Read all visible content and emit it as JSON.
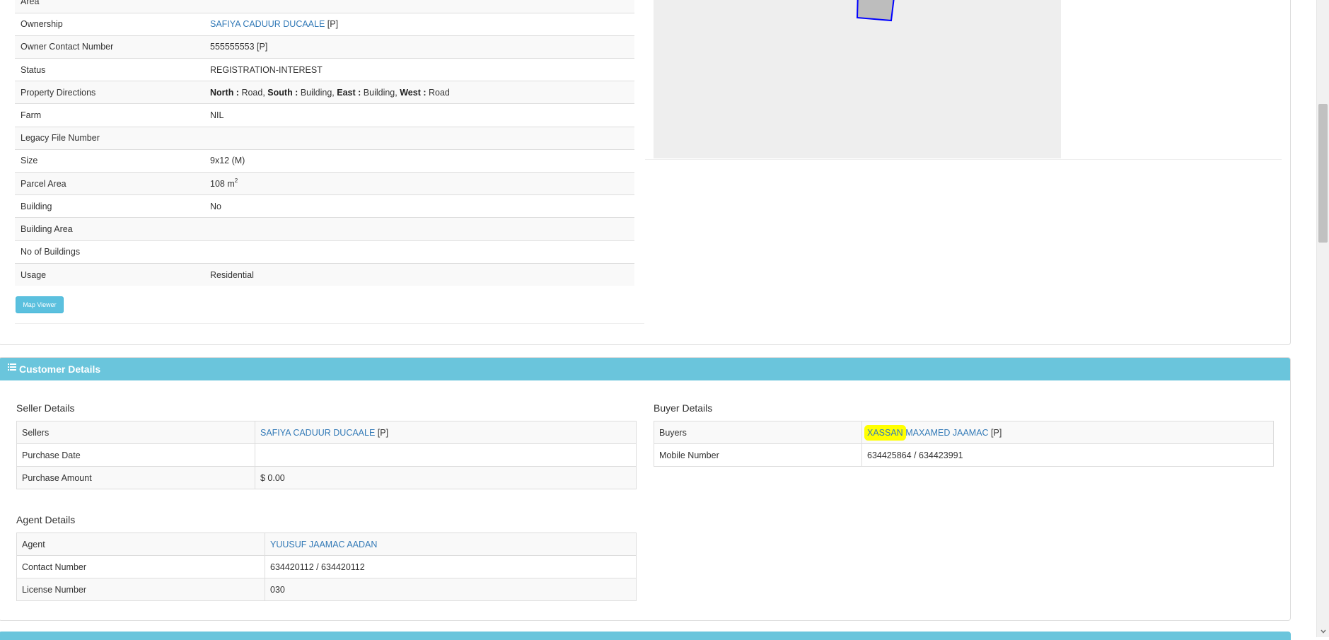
{
  "property": {
    "rows": [
      {
        "label": "Area",
        "value": ""
      },
      {
        "label": "Ownership",
        "value_link": "SAFIYA CADUUR DUCAALE",
        "value_suffix": " [P]"
      },
      {
        "label": "Owner Contact Number",
        "value": "555555553 [P]"
      },
      {
        "label": "Status",
        "value": "REGISTRATION-INTEREST"
      },
      {
        "label": "Property Directions"
      },
      {
        "label": "Farm",
        "value": "NIL"
      },
      {
        "label": "Legacy File Number",
        "value": ""
      },
      {
        "label": "Size",
        "value": "9x12 (M)"
      },
      {
        "label": "Parcel Area",
        "value": "108 m",
        "unit_exp": "2"
      },
      {
        "label": "Building",
        "value": "No"
      },
      {
        "label": "Building Area",
        "value": ""
      },
      {
        "label": "No of Buildings",
        "value": ""
      },
      {
        "label": "Usage",
        "value": "Residential"
      }
    ],
    "directions": {
      "north_label": "North :",
      "north_value": " Road,",
      "south_label": "South :",
      "south_value": " Building,",
      "east_label": "East :",
      "east_value": " Building,",
      "west_label": "West :",
      "west_value": " Road"
    },
    "map_viewer_button": "Map Viewer"
  },
  "map": {
    "background_color": "#eeeeee",
    "parcel_fill": "#bdbdbd",
    "parcel_stroke": "#0000ff"
  },
  "customer": {
    "heading": "Customer Details",
    "heading_icon": "list-icon",
    "seller": {
      "title": "Seller Details",
      "sellers_label": "Sellers",
      "sellers_link": "SAFIYA CADUUR DUCAALE",
      "sellers_suffix": " [P]",
      "purchase_date_label": "Purchase Date",
      "purchase_date_value": "",
      "purchase_amount_label": "Purchase Amount",
      "purchase_amount_value": "$ 0.00"
    },
    "buyer": {
      "title": "Buyer Details",
      "buyers_label": "Buyers",
      "buyers_link_highlight": "XASSAN",
      "buyers_link_rest": " MAXAMED JAAMAC",
      "buyers_suffix": " [P]",
      "mobile_label": "Mobile Number",
      "mobile_value": "634425864 / 634423991"
    },
    "agent": {
      "title": "Agent Details",
      "agent_label": "Agent",
      "agent_link": "YUUSUF JAAMAC AADAN",
      "contact_label": "Contact Number",
      "contact_value": "634420112 / 634420112",
      "license_label": "License Number",
      "license_value": "030"
    }
  },
  "colors": {
    "heading_bg": "#6ac5dc",
    "link": "#337ab7",
    "highlight": "#ffff00",
    "button_bg": "#5bc0de"
  }
}
